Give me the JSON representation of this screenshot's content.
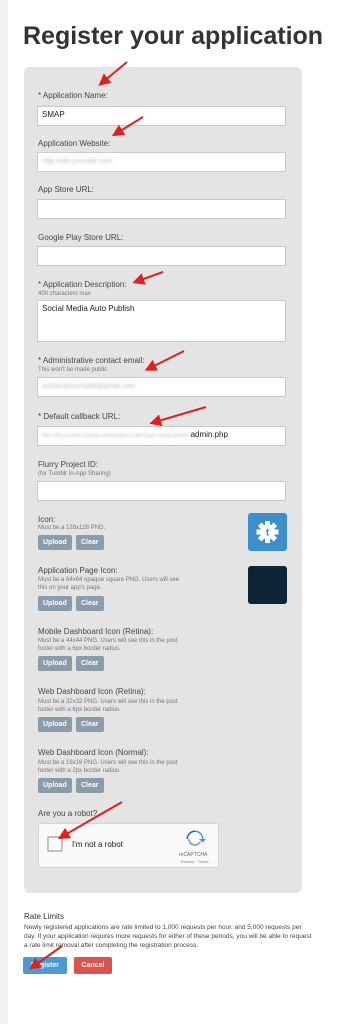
{
  "page": {
    "title": "Register your application"
  },
  "form": {
    "app_name": {
      "label": "* Application Name:",
      "value": "SMAP"
    },
    "app_website": {
      "label": "Application Website:",
      "value": "http://site.yoursite.com"
    },
    "app_store_url": {
      "label": "App Store URL:",
      "value": ""
    },
    "play_store_url": {
      "label": "Google Play Store URL:",
      "value": ""
    },
    "description": {
      "label": "* Application Description:",
      "hint": "400 characters max",
      "value": "Social Media Auto Publish"
    },
    "admin_email": {
      "label": "* Administrative contact email:",
      "hint": "This won't be made public",
      "value": "contactyourmailid@gmail.com"
    },
    "callback_url": {
      "label": "* Default callback URL:",
      "value_blurred": "http://site.yoursite.com/wp-admin/options.php?page=smap-publish-",
      "value_suffix": "admin.php"
    },
    "flurry_id": {
      "label": "Flurry Project ID:",
      "hint": "(for Tumblr In-App Sharing)",
      "value": ""
    },
    "icons": [
      {
        "label": "Icon:",
        "hint": "Must be a 128x128 PNG.",
        "hint2": ""
      },
      {
        "label": "Application Page Icon:",
        "hint": "Must be a 64x64 opaque square PNG. Users will see",
        "hint2": "this on your app's page."
      },
      {
        "label": "Mobile Dashboard Icon (Retina):",
        "hint": "Must be a 44x44 PNG. Users will see this in the post",
        "hint2": "footer with a 6px border radius."
      },
      {
        "label": "Web Dashboard Icon (Retina):",
        "hint": "Must be a 32x32 PNG. Users will see this in the post",
        "hint2": "footer with a 6px border radius."
      },
      {
        "label": "Web Dashboard Icon (Normal):",
        "hint": "Must be a 16x16 PNG. Users will see this in the post",
        "hint2": "footer with a 2px border radius."
      }
    ],
    "upload_label": "Upload",
    "clear_label": "Clear",
    "robot": {
      "label": "Are you a robot?",
      "checkbox_text": "I'm not a robot",
      "brand": "reCAPTCHA",
      "links": "Privacy - Terms"
    }
  },
  "rate_limits": {
    "title": "Rate Limits",
    "text": "Newly registered applications are rate limited to 1,000 requests per hour, and 5,000 requests per day. If your application requires more requests for either of these periods, you will be able to request a rate limit removal after completing the registration process."
  },
  "actions": {
    "register": "Register",
    "cancel": "Cancel"
  },
  "colors": {
    "accent_arrow": "#e02020",
    "register_bg": "#4d9ad0",
    "cancel_bg": "#d9534f",
    "app_icon_bg": "#3e8fc9",
    "page_icon_bg": "#0d2535",
    "panel_bg": "#e4e4e4"
  },
  "icons_semantic": {
    "app_icon": "tumblr-gear-icon",
    "arrows": "red-arrow-annotation"
  }
}
